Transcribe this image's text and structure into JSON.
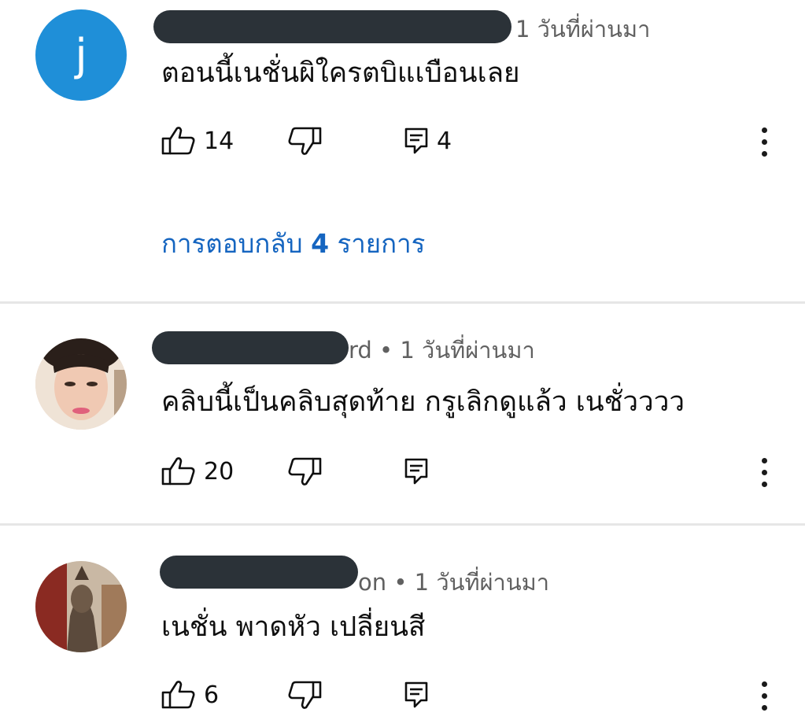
{
  "comments": [
    {
      "avatar_letter": "j",
      "author_suffix": "",
      "time": "1 วันที่ผ่านมา",
      "text": "ตอนนี้เนชั่นผิใครตบิแเบือนเลย",
      "likes": "14",
      "reply_count": "4",
      "replies_link": {
        "prefix": "การตอบกลับ ",
        "count": "4",
        "suffix": " รายการ"
      }
    },
    {
      "author_suffix": "rd",
      "time": "1 วันที่ผ่านมา",
      "text": "คลิบนี้เป็นคลิบสุดท้าย กรูเลิกดูแล้ว เนชั่วววว",
      "likes": "20",
      "reply_count": ""
    },
    {
      "author_suffix": "on",
      "time": "1 วันที่ผ่านมา",
      "text": "เนชั่น พาดหัว เปลี่ยนสี",
      "likes": "6",
      "reply_count": ""
    }
  ],
  "separator": " • ",
  "colors": {
    "link": "#1565c0",
    "avatar_blue": "#1f8fd8",
    "redaction": "#2b3238"
  },
  "icons": [
    "thumb-up-icon",
    "thumb-down-icon",
    "reply-icon",
    "more-vert-icon"
  ]
}
